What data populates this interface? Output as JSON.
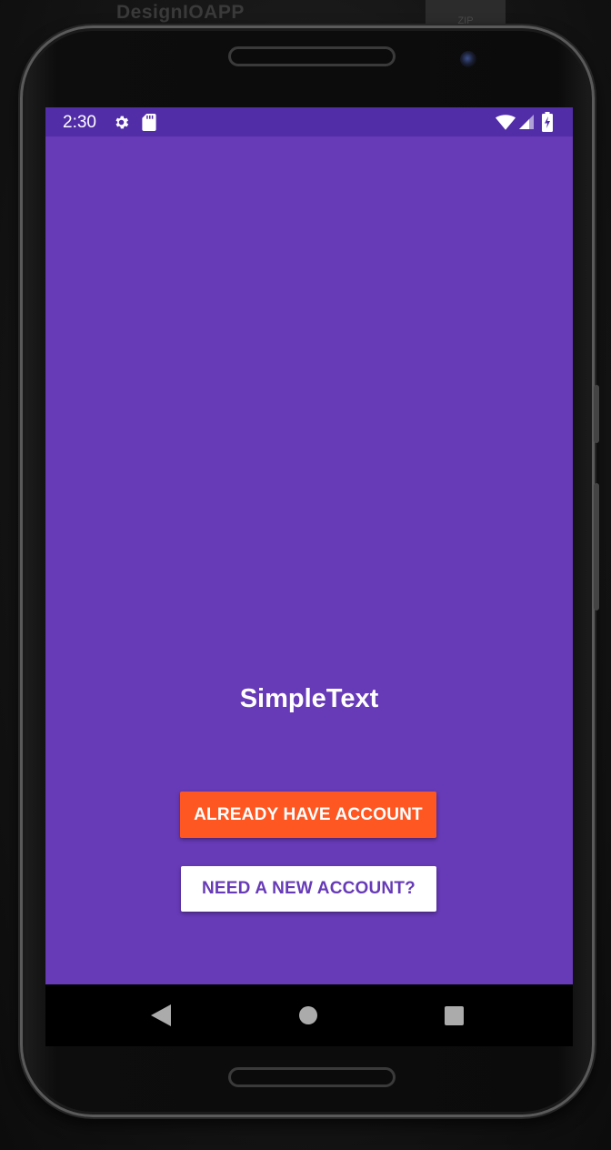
{
  "background": {
    "title": "DesignIOAPP",
    "tab_text": "ZIP"
  },
  "status_bar": {
    "time": "2:30",
    "icons": [
      "gear-icon",
      "sd-card-icon",
      "wifi-icon",
      "signal-icon",
      "battery-charging-icon"
    ]
  },
  "app": {
    "title": "SimpleText",
    "login_button_label": "ALREADY HAVE ACCOUNT",
    "signup_button_label": "NEED A NEW ACCOUNT?"
  },
  "nav_bar": {
    "icons": [
      "back-icon",
      "home-icon",
      "recents-icon"
    ]
  },
  "colors": {
    "primary": "#673ab7",
    "primary_dark": "#512da8",
    "accent": "#ff5722",
    "on_primary": "#ffffff"
  }
}
